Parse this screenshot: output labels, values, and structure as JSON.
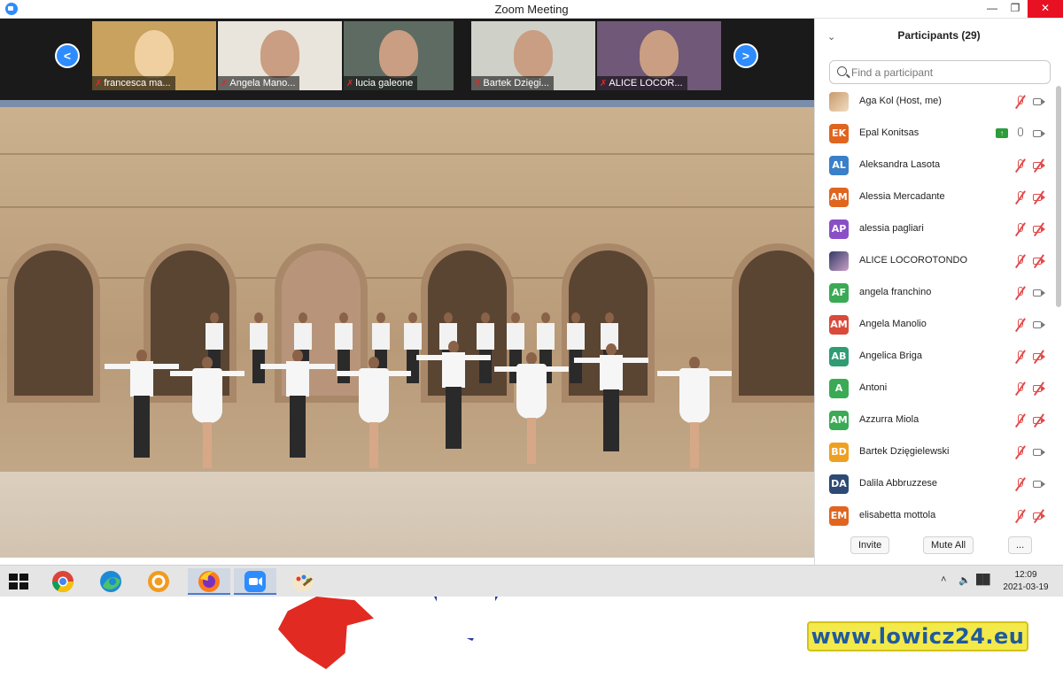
{
  "window": {
    "title": "Zoom Meeting"
  },
  "gallery": {
    "prev_label": "<",
    "next_label": ">",
    "thumbs": [
      {
        "label": "francesca ma...",
        "bg": "#c8a25e"
      },
      {
        "label": "Angela Mano...",
        "bg": "#e9e4dc"
      },
      {
        "label": "lucia galeone",
        "bg": "#5d6b63"
      },
      {
        "label": "Bartek Dzięgi...",
        "bg": "#cfd1c9"
      },
      {
        "label": "ALICE LOCOR...",
        "bg": "#6f5878"
      }
    ]
  },
  "panel": {
    "title": "Participants (29)",
    "search_placeholder": "Find a participant",
    "participants": [
      {
        "name": "Aga Kol (Host, me)",
        "initials": "",
        "color": "",
        "mic": "off",
        "cam": "on",
        "sharing": false
      },
      {
        "name": "Epal Konitsas",
        "initials": "EK",
        "color": "#e0651f",
        "mic": "on",
        "cam": "on",
        "sharing": true
      },
      {
        "name": "Aleksandra Lasota",
        "initials": "AL",
        "color": "#3a7fc8",
        "mic": "off",
        "cam": "off",
        "sharing": false
      },
      {
        "name": "Alessia Mercadante",
        "initials": "AM",
        "color": "#e0651f",
        "mic": "off",
        "cam": "off",
        "sharing": false
      },
      {
        "name": "alessia pagliari",
        "initials": "AP",
        "color": "#8a4fc7",
        "mic": "off",
        "cam": "off",
        "sharing": false
      },
      {
        "name": "ALICE LOCOROTONDO",
        "initials": "",
        "color": "",
        "mic": "off",
        "cam": "off",
        "sharing": false
      },
      {
        "name": "angela franchino",
        "initials": "AF",
        "color": "#3aaa55",
        "mic": "off",
        "cam": "on",
        "sharing": false
      },
      {
        "name": "Angela Manolio",
        "initials": "AM",
        "color": "#d94a3a",
        "mic": "off",
        "cam": "on",
        "sharing": false
      },
      {
        "name": "Angelica Briga",
        "initials": "AB",
        "color": "#2f9c74",
        "mic": "off",
        "cam": "off",
        "sharing": false
      },
      {
        "name": "Antoni",
        "initials": "A",
        "color": "#3aaa55",
        "mic": "off",
        "cam": "off",
        "sharing": false
      },
      {
        "name": "Azzurra Miola",
        "initials": "AM",
        "color": "#3aaa55",
        "mic": "off",
        "cam": "off",
        "sharing": false
      },
      {
        "name": "Bartek Dzięgielewski",
        "initials": "BD",
        "color": "#f0a020",
        "mic": "off",
        "cam": "on",
        "sharing": false
      },
      {
        "name": "Dalila Abbruzzese",
        "initials": "DA",
        "color": "#2c4a74",
        "mic": "off",
        "cam": "on",
        "sharing": false
      },
      {
        "name": "elisabetta mottola",
        "initials": "EM",
        "color": "#e0651f",
        "mic": "off",
        "cam": "off",
        "sharing": false
      }
    ],
    "invite_label": "Invite",
    "mute_all_label": "Mute All",
    "more_label": "..."
  },
  "taskbar": {
    "apps": [
      "start-icon",
      "chrome-icon",
      "edge-icon",
      "settings-icon",
      "firefox-icon",
      "zoom-icon",
      "paint-icon"
    ],
    "time": "12:09",
    "date": "2021-03-19"
  },
  "desktop": {
    "watermark": "www.lowicz24.eu"
  }
}
